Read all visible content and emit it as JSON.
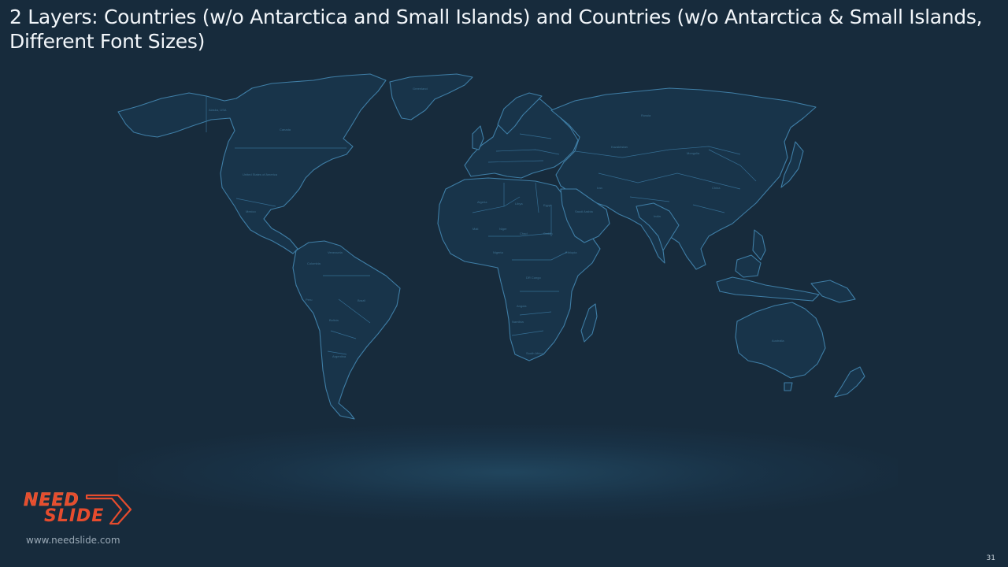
{
  "slide": {
    "title": "2 Layers: Countries (w/o Antarctica and Small Islands) and Countries (w/o Antarctica & Small Islands, Different Font Sizes)",
    "website": "www.needslide.com",
    "page_number": "31"
  },
  "logo": {
    "line1": "NEED",
    "line2": "SLIDE",
    "color": "#e64c2e"
  },
  "map": {
    "background": "#172b3c",
    "outline_color": "#3f7ea6",
    "labels": {
      "alaska": "Alaska, USA",
      "canada": "Canada",
      "usa": "United States of America",
      "mexico": "Mexico",
      "greenland": "Greenland",
      "brazil": "Brazil",
      "peru": "Peru",
      "bolivia": "Bolivia",
      "argentina": "Argentina",
      "colombia": "Colombia",
      "venezuela": "Venezuela",
      "algeria": "Algeria",
      "libya": "Libya",
      "egypt": "Egypt",
      "mali": "Mali",
      "niger": "Niger",
      "chad": "Chad",
      "sudan": "Sudan",
      "ethiopia": "Ethiopia",
      "nigeria": "Nigeria",
      "drc": "DR Congo",
      "angola": "Angola",
      "namibia": "Namibia",
      "south_africa": "South Africa",
      "saudi_arabia": "Saudi Arabia",
      "iran": "Iran",
      "kazakhstan": "Kazakhstan",
      "russia": "Russia",
      "mongolia": "Mongolia",
      "china": "China",
      "india": "India",
      "australia": "Australia"
    }
  }
}
